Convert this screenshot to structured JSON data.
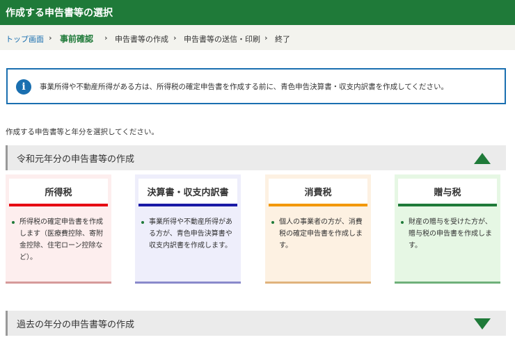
{
  "header": {
    "title": "作成する申告書等の選択"
  },
  "breadcrumb": {
    "items": [
      {
        "label": "トップ画面"
      },
      {
        "label": "事前確認"
      },
      {
        "label": "申告書等の作成"
      },
      {
        "label": "申告書等の送信・印刷"
      },
      {
        "label": "終了"
      }
    ],
    "separator": "›"
  },
  "notice": {
    "icon": "info-icon",
    "icon_glyph": "i",
    "text": "事業所得や不動産所得がある方は、所得税の確定申告書を作成する前に、青色申告決算書・収支内訳書を作成してください。"
  },
  "instruction": "作成する申告書等と年分を選択してください。",
  "sections": [
    {
      "label": "令和元年分の申告書等の作成",
      "state": "expanded",
      "arrow_icon": "triangle-up-icon"
    },
    {
      "label": "過去の年分の申告書等の作成",
      "state": "collapsed",
      "arrow_icon": "triangle-down-icon"
    }
  ],
  "cards": [
    {
      "title": "所得税",
      "description": "所得税の確定申告書を作成します（医療費控除、寄附金控除、住宅ローン控除など）。",
      "accent": "#e60012",
      "bg": "#fdeeee",
      "foot": "#d69a9a"
    },
    {
      "title": "決算書・収支内訳書",
      "description": "事業所得や不動産所得がある方が、青色申告決算書や収支内訳書を作成します。",
      "accent": "#1a1aa6",
      "bg": "#eeeefb",
      "foot": "#8a8acb"
    },
    {
      "title": "消費税",
      "description": "個人の事業者の方が、消費税の確定申告書を作成します。",
      "accent": "#f39800",
      "bg": "#fdf1e2",
      "foot": "#e0b37c"
    },
    {
      "title": "贈与税",
      "description": "財産の贈与を受けた方が、贈与税の申告書を作成します。",
      "accent": "#1f7a39",
      "bg": "#e6f7e4",
      "foot": "#6fb07a"
    }
  ],
  "colors": {
    "brand_green": "#1f7a39",
    "link_blue": "#1a6fb0"
  }
}
